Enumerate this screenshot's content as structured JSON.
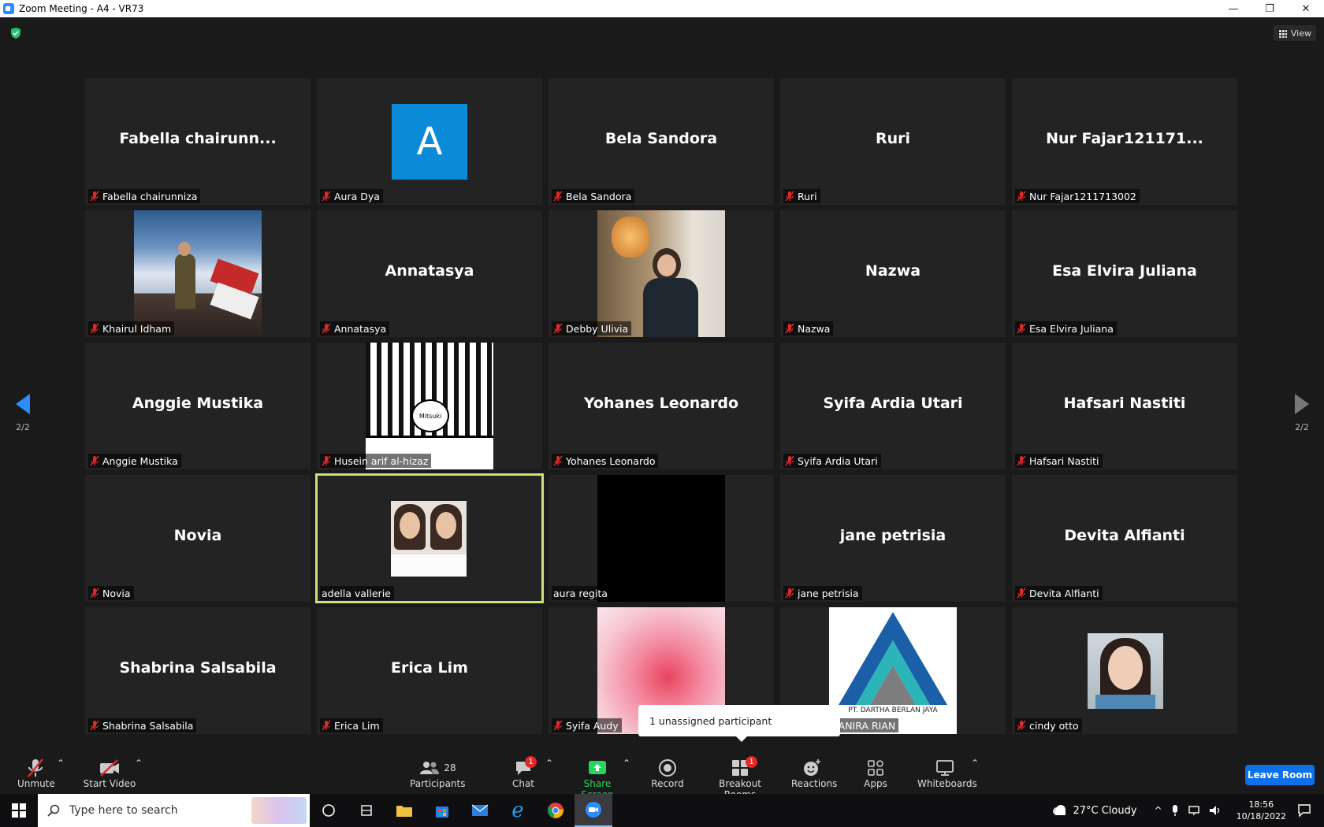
{
  "window": {
    "title": "Zoom Meeting - A4 - VR73",
    "controls": [
      "—",
      "❐",
      "✕"
    ]
  },
  "view_button": {
    "label": "View"
  },
  "pager": {
    "left": "2/2",
    "right": "2/2"
  },
  "tiles": [
    {
      "big": "Fabella  chairunn...",
      "label": "Fabella chairunniza",
      "muted": true,
      "kind": "name"
    },
    {
      "big": "A",
      "label": "Aura Dya",
      "muted": true,
      "kind": "avatar"
    },
    {
      "big": "Bela Sandora",
      "label": "Bela Sandora",
      "muted": true,
      "kind": "name"
    },
    {
      "big": "Ruri",
      "label": "Ruri",
      "muted": true,
      "kind": "name"
    },
    {
      "big": "Nur  Fajar121171...",
      "label": "Nur Fajar1211713002",
      "muted": true,
      "kind": "name"
    },
    {
      "big": "",
      "label": "Khairul Idham",
      "muted": true,
      "kind": "photo-mountain"
    },
    {
      "big": "Annatasya",
      "label": "Annatasya",
      "muted": true,
      "kind": "name"
    },
    {
      "big": "",
      "label": "Debby Ulivia",
      "muted": true,
      "kind": "photo-cafe"
    },
    {
      "big": "Nazwa",
      "label": "Nazwa",
      "muted": true,
      "kind": "name"
    },
    {
      "big": "Esa Elvira Juliana",
      "label": "Esa Elvira Juliana",
      "muted": true,
      "kind": "name"
    },
    {
      "big": "Anggie Mustika",
      "label": "Anggie Mustika",
      "muted": true,
      "kind": "name"
    },
    {
      "big": "",
      "label": "Husein arif al-hizaz",
      "muted": true,
      "kind": "photo-manga"
    },
    {
      "big": "Yohanes Leonardo",
      "label": "Yohanes Leonardo",
      "muted": true,
      "kind": "name"
    },
    {
      "big": "Syifa Ardia Utari",
      "label": "Syifa Ardia Utari",
      "muted": true,
      "kind": "name"
    },
    {
      "big": "Hafsari Nastiti",
      "label": "Hafsari Nastiti",
      "muted": true,
      "kind": "name"
    },
    {
      "big": "Novia",
      "label": "Novia",
      "muted": true,
      "kind": "name"
    },
    {
      "big": "",
      "label": "adella vallerie",
      "muted": false,
      "kind": "photo-selfie",
      "active": true
    },
    {
      "big": "",
      "label": "aura regita",
      "muted": false,
      "kind": "photo-black"
    },
    {
      "big": "jane petrisia",
      "label": "jane petrisia",
      "muted": true,
      "kind": "name"
    },
    {
      "big": "Devita Alfianti",
      "label": "Devita Alfianti",
      "muted": true,
      "kind": "name"
    },
    {
      "big": "Shabrina Salsabila",
      "label": "Shabrina Salsabila",
      "muted": true,
      "kind": "name"
    },
    {
      "big": "Erica Lim",
      "label": "Erica Lim",
      "muted": true,
      "kind": "name"
    },
    {
      "big": "",
      "label": "Syifa Audy",
      "muted": true,
      "kind": "photo-pink"
    },
    {
      "big": "",
      "label": "NOFRIAL DANIRA RIAN",
      "muted": false,
      "kind": "photo-logo",
      "logo_text": "PT. DARTHA BERLAN JAYA"
    },
    {
      "big": "",
      "label": "cindy otto",
      "muted": true,
      "kind": "photo-girl"
    }
  ],
  "tooltip": {
    "text": "1 unassigned participant"
  },
  "toolbar": {
    "unmute": "Unmute",
    "start_video": "Start Video",
    "participants": "Participants",
    "participants_count": "28",
    "chat": "Chat",
    "chat_badge": "1",
    "share_screen": "Share Screen",
    "record": "Record",
    "breakout": "Breakout Rooms",
    "breakout_badge": "1",
    "reactions": "Reactions",
    "apps": "Apps",
    "whiteboards": "Whiteboards",
    "leave": "Leave Room"
  },
  "taskbar": {
    "search_placeholder": "Type here to search",
    "weather": "27°C  Cloudy",
    "time": "18:56",
    "date": "10/18/2022"
  },
  "colors": {
    "accent": "#2d8cff",
    "active_speaker": "#c7e37a",
    "muted_red": "#e02828",
    "share_green": "#23d959"
  }
}
